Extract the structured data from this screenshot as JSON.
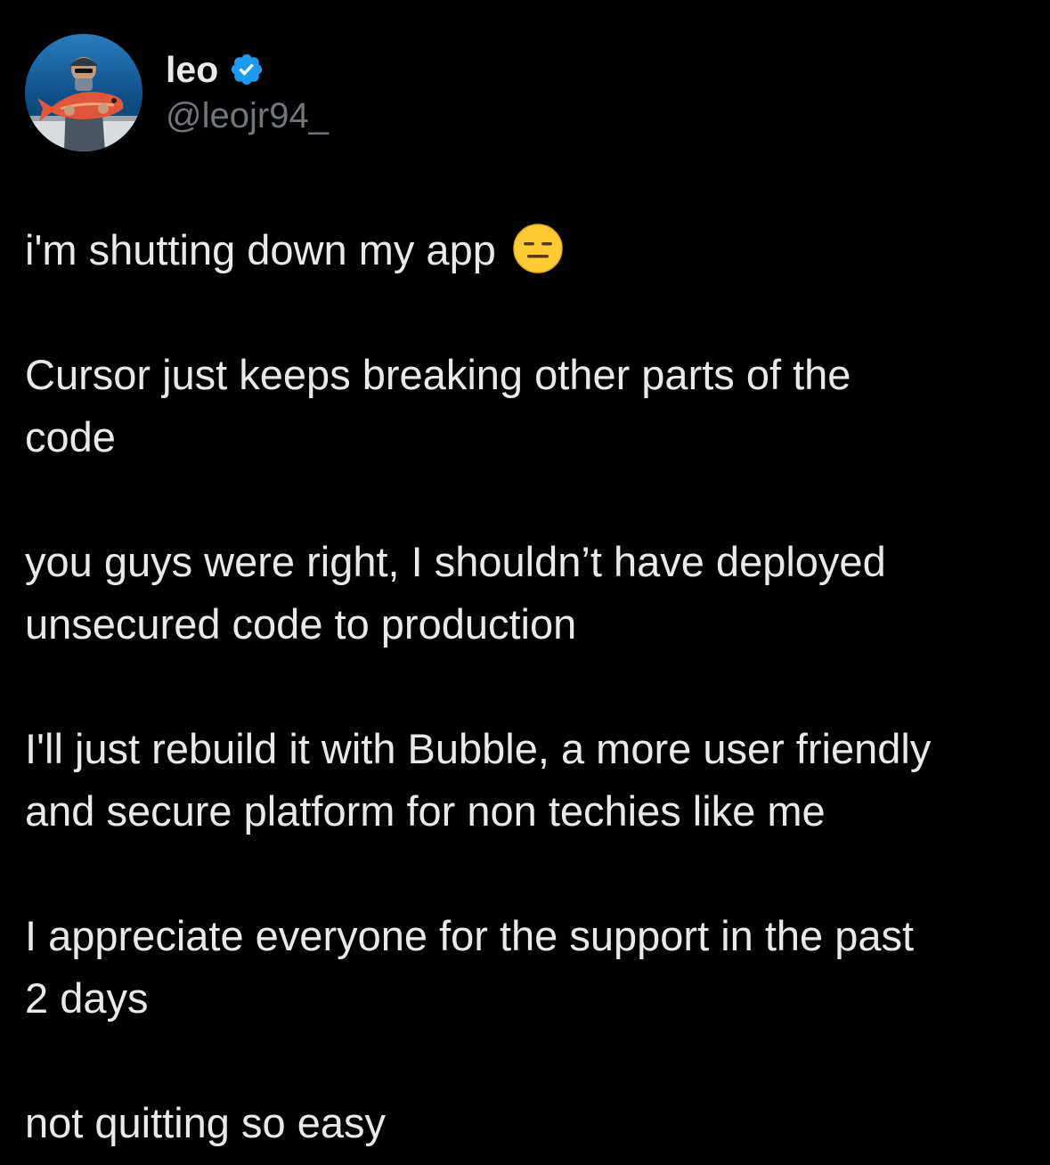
{
  "author": {
    "display_name": "leo",
    "handle": "@leojr94_",
    "verified": true,
    "avatar_icon": "profile-photo-fisherman-with-fish",
    "verified_icon": "verified-badge-icon"
  },
  "colors": {
    "background": "#000000",
    "text": "#e7e9ea",
    "secondary_text": "#71767b",
    "verified_blue": "#1d9bf0",
    "emoji_yellow": "#ffcc33"
  },
  "tweet": {
    "paragraphs": [
      "i'm shutting down my app",
      "Cursor just keeps breaking other parts of the\ncode",
      "you guys were right, I shouldn’t have deployed\nunsecured code to production",
      "I'll just rebuild it with Bubble, a more user friendly\nand secure platform for non techies like me",
      "I appreciate everyone for the support in the past\n2 days",
      "not quitting so easy"
    ],
    "first_paragraph_emoji": "expressionless-face-emoji"
  }
}
